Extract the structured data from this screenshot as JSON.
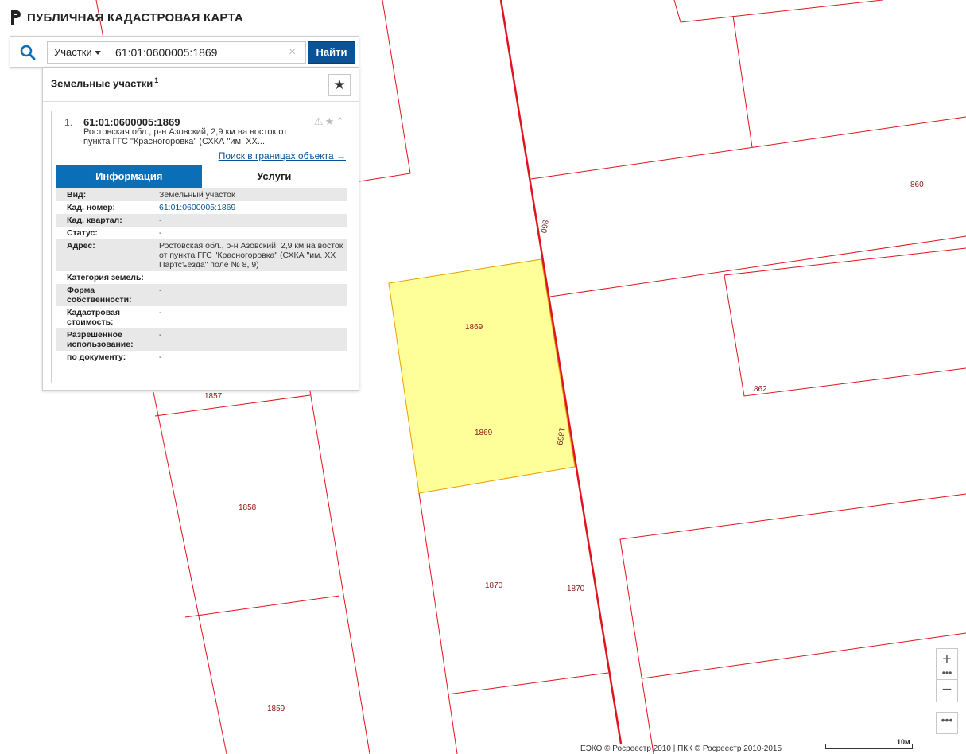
{
  "app": {
    "title": "ПУБЛИЧНАЯ КАДАСТРОВАЯ КАРТА"
  },
  "search": {
    "type_label": "Участки",
    "query": "61:01:0600005:1869",
    "find_label": "Найти"
  },
  "results": {
    "title": "Земельные участки",
    "count": "1",
    "items": [
      {
        "number": "1.",
        "cadnum": "61:01:0600005:1869",
        "address_short": "Ростовская обл., р-н Азовский, 2,9 км на восток от пункта ГГС \"Красногоровка\" (СХКА \"им. ХХ...",
        "search_link": "Поиск в границах объекта →"
      }
    ],
    "tabs": {
      "info": "Информация",
      "services": "Услуги"
    },
    "info_rows": [
      {
        "key": "Вид:",
        "value": "Земельный участок"
      },
      {
        "key": "Кад. номер:",
        "value": "61:01:0600005:1869"
      },
      {
        "key": "Кад. квартал:",
        "value": "-"
      },
      {
        "key": "Статус:",
        "value": "-"
      },
      {
        "key": "Адрес:",
        "value": "Ростовская обл., р-н Азовский, 2,9 км на восток от пункта ГГС \"Красногоровка\" (СХКА \"им. ХХ Партсъезда\" поле № 8, 9)"
      },
      {
        "key": "Категория земель:",
        "value": ""
      },
      {
        "key": "Форма собственности:",
        "value": "-"
      },
      {
        "key": "Кадастровая стоимость:",
        "value": "-"
      },
      {
        "key": "Разрешенное использование:",
        "value": "-"
      },
      {
        "key": "по документу:",
        "value": "-"
      }
    ]
  },
  "map": {
    "parcel_labels": [
      "860",
      "860",
      "862",
      "1869",
      "1869",
      "1869",
      "1857",
      "1858",
      "1870",
      "1870",
      "1859"
    ],
    "highlight_color": "#ffff99",
    "boundary_color": "#e0141e",
    "label_color": "#8b1a1a"
  },
  "controls": {
    "zoom_in": "+",
    "zoom_out": "−",
    "more": "•••"
  },
  "footer": {
    "attribution": "ЕЭКО © Росреестр 2010 | ПКК © Росреестр 2010-2015",
    "scale": "10м"
  }
}
